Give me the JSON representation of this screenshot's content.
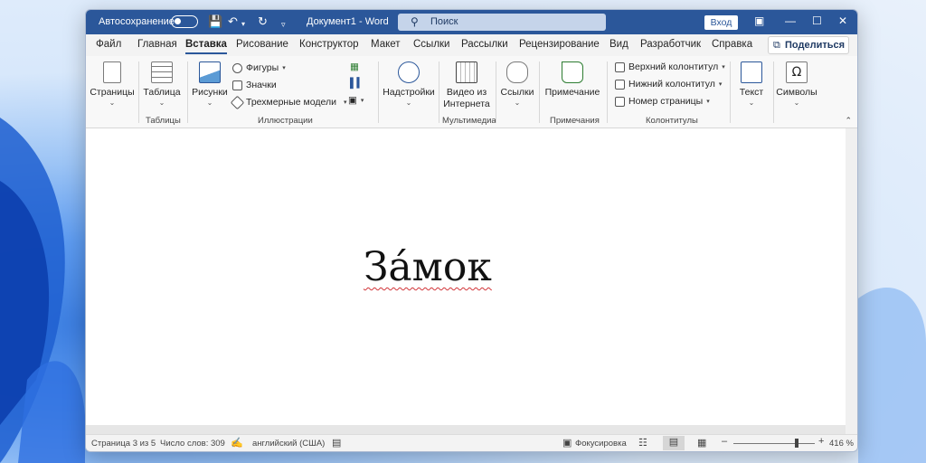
{
  "titlebar": {
    "autosave_label": "Автосохранение",
    "doc_title": "Документ1  -  Word",
    "search_placeholder": "Поиск",
    "login_label": "Вход"
  },
  "tabs": [
    {
      "label": "Файл"
    },
    {
      "label": "Главная"
    },
    {
      "label": "Вставка"
    },
    {
      "label": "Рисование"
    },
    {
      "label": "Конструктор"
    },
    {
      "label": "Макет"
    },
    {
      "label": "Ссылки"
    },
    {
      "label": "Рассылки"
    },
    {
      "label": "Рецензирование"
    },
    {
      "label": "Вид"
    },
    {
      "label": "Разработчик"
    },
    {
      "label": "Справка"
    }
  ],
  "share_label": "Поделиться",
  "ribbon": {
    "pages": "Страницы",
    "table": "Таблица",
    "tables_group": "Таблицы",
    "pictures": "Рисунки",
    "shapes": "Фигуры",
    "icons": "Значки",
    "models3d": "Трехмерные модели",
    "illustrations_group": "Иллюстрации",
    "addins": "Надстройки",
    "video_line1": "Видео из",
    "video_line2": "Интернета",
    "media_group": "Мультимедиа",
    "links": "Ссылки",
    "comment": "Примечание",
    "comments_group": "Примечания",
    "header": "Верхний колонтитул",
    "footer": "Нижний колонтитул",
    "page_number": "Номер страницы",
    "headerfooter_group": "Колонтитулы",
    "text": "Текст",
    "symbols": "Символы"
  },
  "document": {
    "content": "За́мок"
  },
  "status": {
    "page": "Страница 3 из 5",
    "words": "Число слов: 309",
    "language": "английский (США)",
    "focus": "Фокусировка",
    "zoom": "416 %",
    "zoom_fraction": 0.78
  },
  "colors": {
    "accent": "#2b579a",
    "spell_underline": "#d13438"
  }
}
